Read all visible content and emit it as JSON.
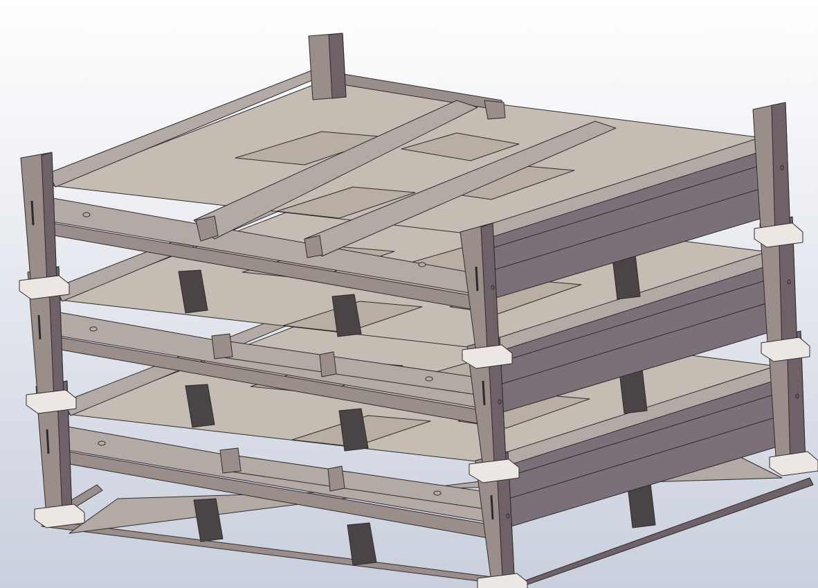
{
  "scene": {
    "subject": "3D CAD model",
    "tiers": 3,
    "colors": {
      "background_top": "#ffffff",
      "background_bottom": "#c9cfdd",
      "frame_lit": "#b3a9a5",
      "frame_mid": "#9a8e8a",
      "frame_dark": "#6e6268",
      "rail_side_dark": "#7b6f79",
      "deck": "#c5bdb3",
      "deck_inset": "#b8aea4",
      "foot_block": "#4a4446",
      "corner_cap": "#ece7e2",
      "edge_line": "#2e2a2c"
    }
  }
}
